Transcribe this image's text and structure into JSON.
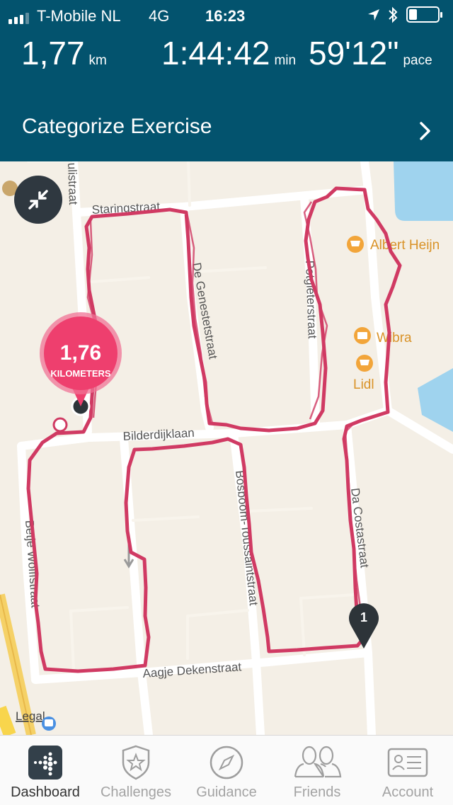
{
  "status_bar": {
    "carrier": "T-Mobile NL",
    "network": "4G",
    "time": "16:23"
  },
  "stats": {
    "distance_value": "1,77",
    "distance_unit": "km",
    "duration_value": "1:44:42",
    "duration_unit": "min",
    "pace_value": "59'12\"",
    "pace_unit": "pace"
  },
  "categorize": {
    "label": "Categorize Exercise"
  },
  "map": {
    "marker_value": "1,76",
    "marker_unit": "KILOMETERS",
    "pin_number": "1",
    "legal": "Legal",
    "streets": {
      "s1": "Staringstraat",
      "s2": "De Genestetstraat",
      "s3": "Potgieterstraat",
      "s4": "Bilderdijklaan",
      "s5": "Bosboom-Toussaintstraat",
      "s6": "Da Costastraat",
      "s7": "Betje Wolffstraat",
      "s8": "Aagje Dekenstraat",
      "s9": "ulistraat"
    },
    "pois": {
      "p1": "Albert Heijn",
      "p2": "Wibra",
      "p3": "Lidl"
    },
    "route_color": "#d23a62",
    "marker_color": "#ee3f6e"
  },
  "tabs": [
    {
      "label": "Dashboard",
      "icon": "dashboard-icon"
    },
    {
      "label": "Challenges",
      "icon": "challenges-icon"
    },
    {
      "label": "Guidance",
      "icon": "compass-icon"
    },
    {
      "label": "Friends",
      "icon": "friends-icon"
    },
    {
      "label": "Account",
      "icon": "account-icon"
    }
  ]
}
